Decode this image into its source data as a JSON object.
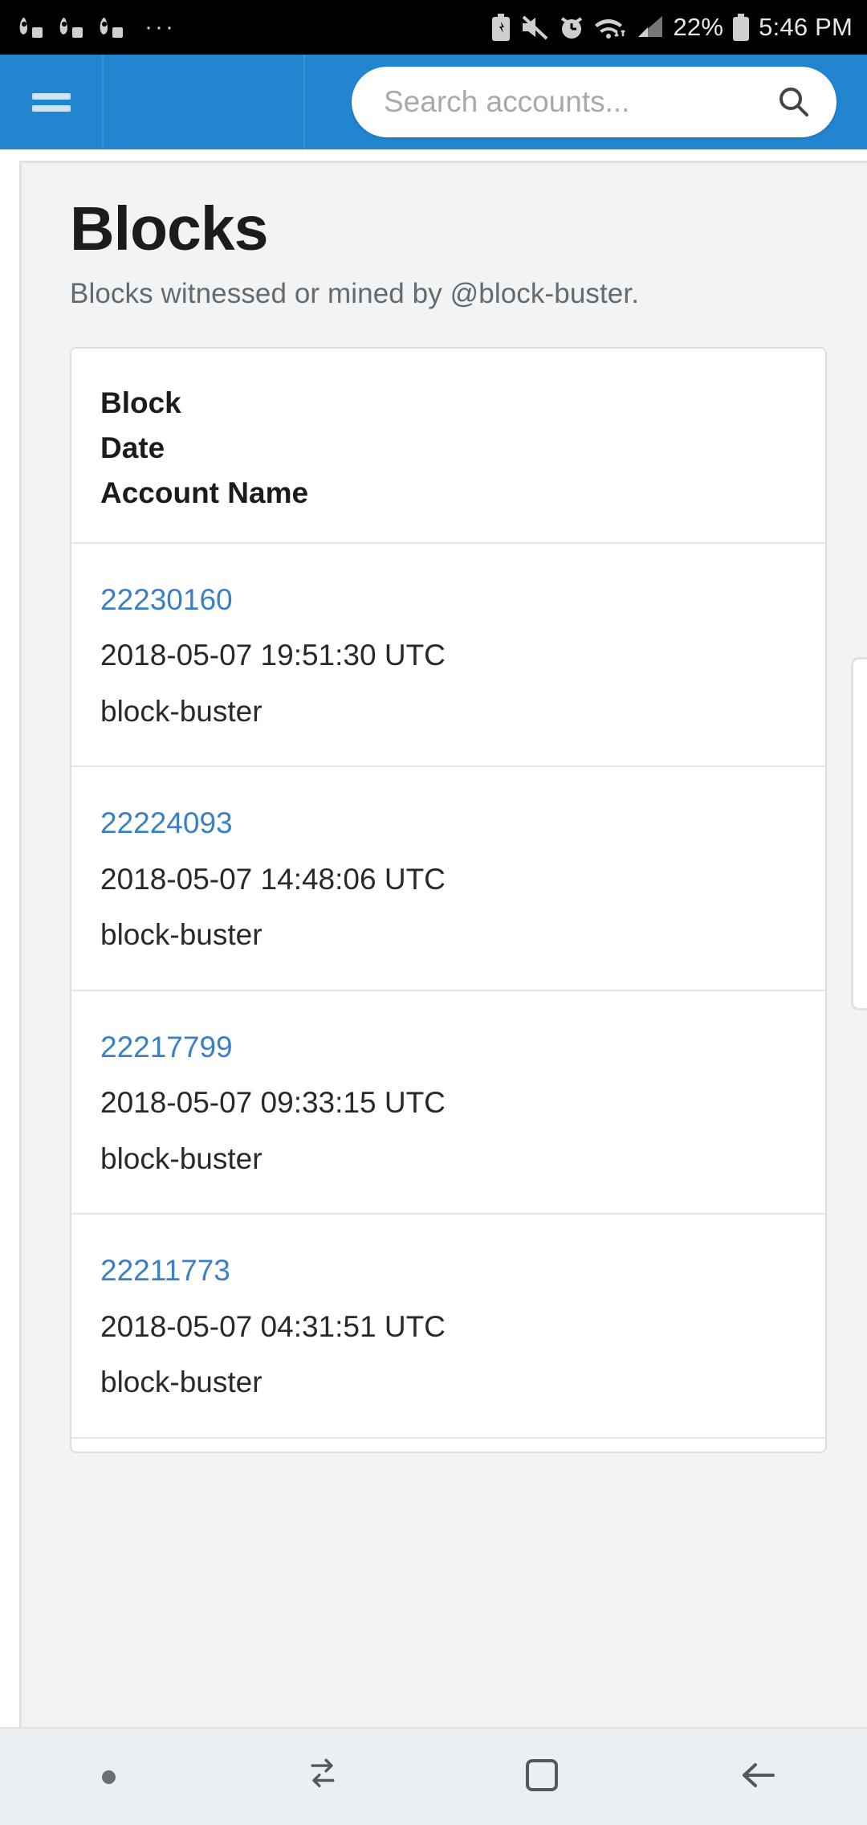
{
  "status_bar": {
    "notification_icons": [
      "game-controller-icon",
      "game-controller-icon",
      "game-controller-icon"
    ],
    "overflow": "···",
    "system_icons": [
      "battery-saver-icon",
      "mute-icon",
      "alarm-icon",
      "wifi-icon",
      "signal-icon"
    ],
    "battery_percent": "22%",
    "time": "5:46 PM"
  },
  "appbar": {
    "menu_icon": "hamburger-menu-icon",
    "search_placeholder": "Search accounts...",
    "search_value": "",
    "search_icon": "search-icon",
    "background_color": "#2185d0"
  },
  "page": {
    "title": "Blocks",
    "subtitle": "Blocks witnessed or mined by @block-buster.",
    "link_color": "#3b7fc4",
    "background_color": "#f1f3f5"
  },
  "table": {
    "headers": [
      "Block",
      "Date",
      "Account Name"
    ],
    "rows": [
      {
        "block": "22230160",
        "date": "2018-05-07 19:51:30 UTC",
        "account": "block-buster"
      },
      {
        "block": "22224093",
        "date": "2018-05-07 14:48:06 UTC",
        "account": "block-buster"
      },
      {
        "block": "22217799",
        "date": "2018-05-07 09:33:15 UTC",
        "account": "block-buster"
      },
      {
        "block": "22211773",
        "date": "2018-05-07 04:31:51 UTC",
        "account": "block-buster"
      }
    ]
  },
  "navbar": {
    "buttons": [
      "dot-indicator",
      "recents-icon",
      "home-icon",
      "back-icon"
    ]
  }
}
